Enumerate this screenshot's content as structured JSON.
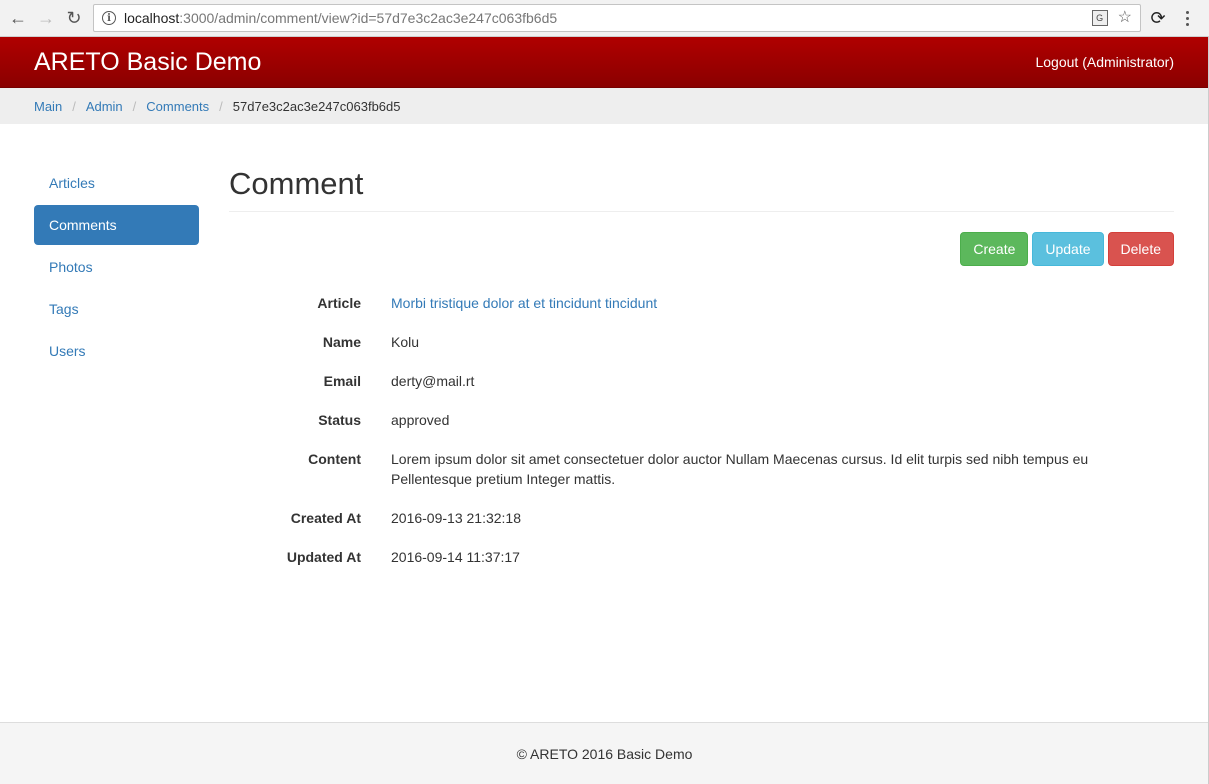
{
  "browser": {
    "url_host": "localhost",
    "url_rest": ":3000/admin/comment/view?id=57d7e3c2ac3e247c063fb6d5"
  },
  "navbar": {
    "brand": "ARETO Basic Demo",
    "logout": "Logout (Administrator)"
  },
  "breadcrumb": {
    "items": [
      "Main",
      "Admin",
      "Comments"
    ],
    "active": "57d7e3c2ac3e247c063fb6d5"
  },
  "sidebar": {
    "items": [
      {
        "label": "Articles",
        "active": false
      },
      {
        "label": "Comments",
        "active": true
      },
      {
        "label": "Photos",
        "active": false
      },
      {
        "label": "Tags",
        "active": false
      },
      {
        "label": "Users",
        "active": false
      }
    ]
  },
  "page": {
    "title": "Comment",
    "actions": {
      "create": "Create",
      "update": "Update",
      "delete": "Delete"
    }
  },
  "details": [
    {
      "label": "Article",
      "value": "Morbi tristique dolor at et tincidunt tincidunt",
      "link": true
    },
    {
      "label": "Name",
      "value": "Kolu",
      "link": false
    },
    {
      "label": "Email",
      "value": "derty@mail.rt",
      "link": false
    },
    {
      "label": "Status",
      "value": "approved",
      "link": false
    },
    {
      "label": "Content",
      "value": "Lorem ipsum dolor sit amet consectetuer dolor auctor Nullam Maecenas cursus. Id elit turpis sed nibh tempus eu Pellentesque pretium Integer mattis.",
      "link": false
    },
    {
      "label": "Created At",
      "value": "2016-09-13 21:32:18",
      "link": false
    },
    {
      "label": "Updated At",
      "value": "2016-09-14 11:37:17",
      "link": false
    }
  ],
  "footer": {
    "text": "© ARETO 2016 Basic Demo"
  },
  "colors": {
    "navbar": "#9b0000",
    "link": "#337ab7",
    "create": "#5cb85c",
    "update": "#5bc0de",
    "delete": "#d9534f"
  }
}
